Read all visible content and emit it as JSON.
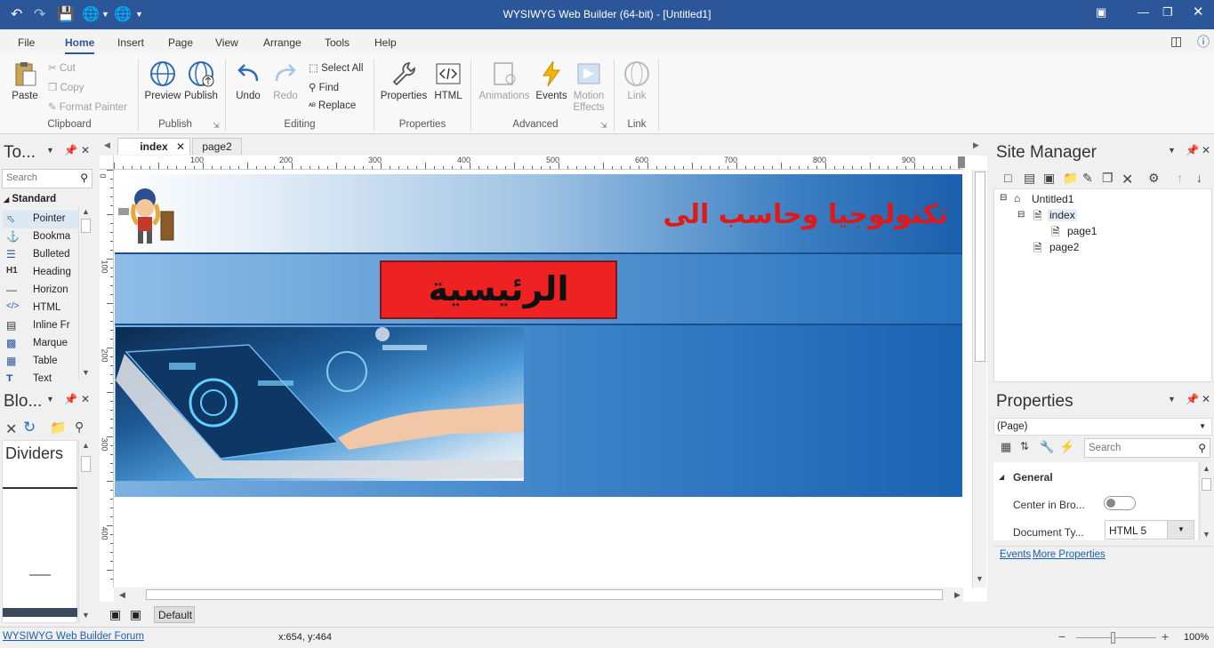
{
  "app": {
    "title": "WYSIWYG Web Builder (64-bit) - [Untitled1]"
  },
  "menu": [
    "File",
    "Home",
    "Insert",
    "Page",
    "View",
    "Arrange",
    "Tools",
    "Help"
  ],
  "ribbon": {
    "paste": "Paste",
    "cut": "Cut",
    "copy": "Copy",
    "format_painter": "Format Painter",
    "clipboard": "Clipboard",
    "preview": "Preview",
    "publish": "Publish",
    "publish_group": "Publish",
    "undo": "Undo",
    "redo": "Redo",
    "select_all": "Select All",
    "find": "Find",
    "replace": "Replace",
    "editing": "Editing",
    "properties": "Properties",
    "html": "HTML",
    "properties_group": "Properties",
    "animations": "Animations",
    "events": "Events",
    "motion_effects_1": "Motion",
    "motion_effects_2": "Effects",
    "advanced": "Advanced",
    "link": "Link",
    "link_group": "Link"
  },
  "toolbox": {
    "title": "To...",
    "search_placeholder": "Search",
    "category": "Standard",
    "items": [
      "Pointer",
      "Bookma",
      "Bulleted",
      "Heading",
      "Horizon",
      "HTML",
      "Inline Fr",
      "Marque",
      "Table",
      "Text"
    ]
  },
  "blocks": {
    "title": "Blo...",
    "section": "Dividers"
  },
  "tabs": [
    "index",
    "page2"
  ],
  "ruler": {
    "h": [
      "100",
      "200",
      "300",
      "400",
      "500",
      "600",
      "700",
      "800",
      "900"
    ],
    "v": [
      "0",
      "100",
      "200",
      "300",
      "400"
    ]
  },
  "page": {
    "site_title": "تكنولوجيا وحاسب الى",
    "home_button": "الرئيسية"
  },
  "site_manager": {
    "title": "Site Manager",
    "tree": [
      "Untitled1",
      "index",
      "page1",
      "page2"
    ]
  },
  "properties": {
    "title": "Properties",
    "selector": "(Page)",
    "search_placeholder": "Search",
    "group": "General",
    "center_label": "Center in Bro...",
    "center_value": false,
    "doctype_label": "Document Ty...",
    "doctype_value": "HTML 5",
    "events_link": "Events",
    "more_link": "More Properties"
  },
  "bottom": {
    "layer": "Default"
  },
  "status": {
    "forum_link": "WYSIWYG Web Builder Forum",
    "coords": "x:654, y:464",
    "zoom": "100%",
    "zoom_fraction": 0.45
  }
}
